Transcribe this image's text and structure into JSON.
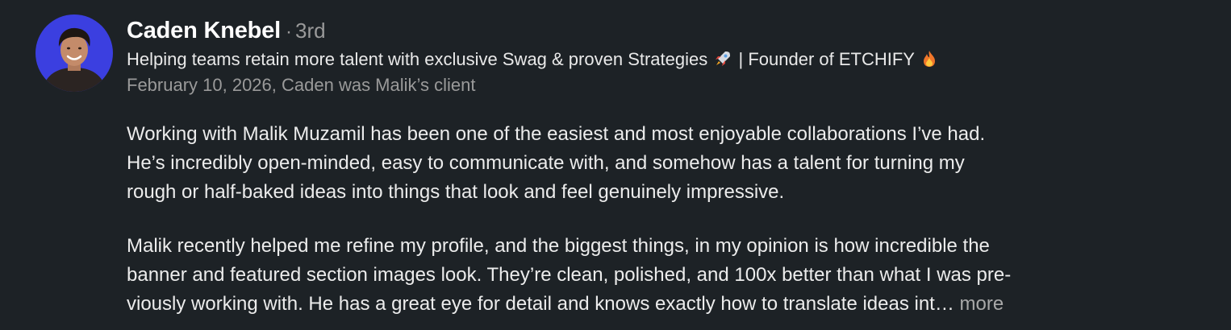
{
  "recommender": {
    "name": "Caden Knebel",
    "degree_separator": "·",
    "degree": "3rd",
    "headline_part1": "Helping teams retain more talent with exclusive Swag & proven Strategies",
    "headline_part2": "| Founder of ETCHIFY",
    "headline_icons": [
      "rocket-emoji",
      "fire-emoji"
    ],
    "meta": "February 10, 2026, Caden was Malik’s client"
  },
  "recommendation": {
    "paragraph1_lines": [
      "Working with Malik Muzamil has been one of the easiest and most enjoyable collaborations I’ve had.",
      "He’s incredibly open-minded, easy to communicate with, and somehow has a talent for turning my",
      "rough or half-baked ideas into things that look and feel genuinely impressive."
    ],
    "paragraph2_lines": [
      "Malik recently helped me refine my profile, and the biggest things, in my opinion is how incredible the",
      "banner and featured section images look. They’re clean, polished, and 100x better than what I was pre-",
      "viously working with. He has a great eye for detail and knows exactly how to translate ideas int…"
    ],
    "more_label": "more"
  },
  "colors": {
    "background": "#1d2226",
    "avatar_background": "#3b3fe0",
    "primary_text": "#ffffff",
    "secondary_text": "#9a9a9a"
  }
}
